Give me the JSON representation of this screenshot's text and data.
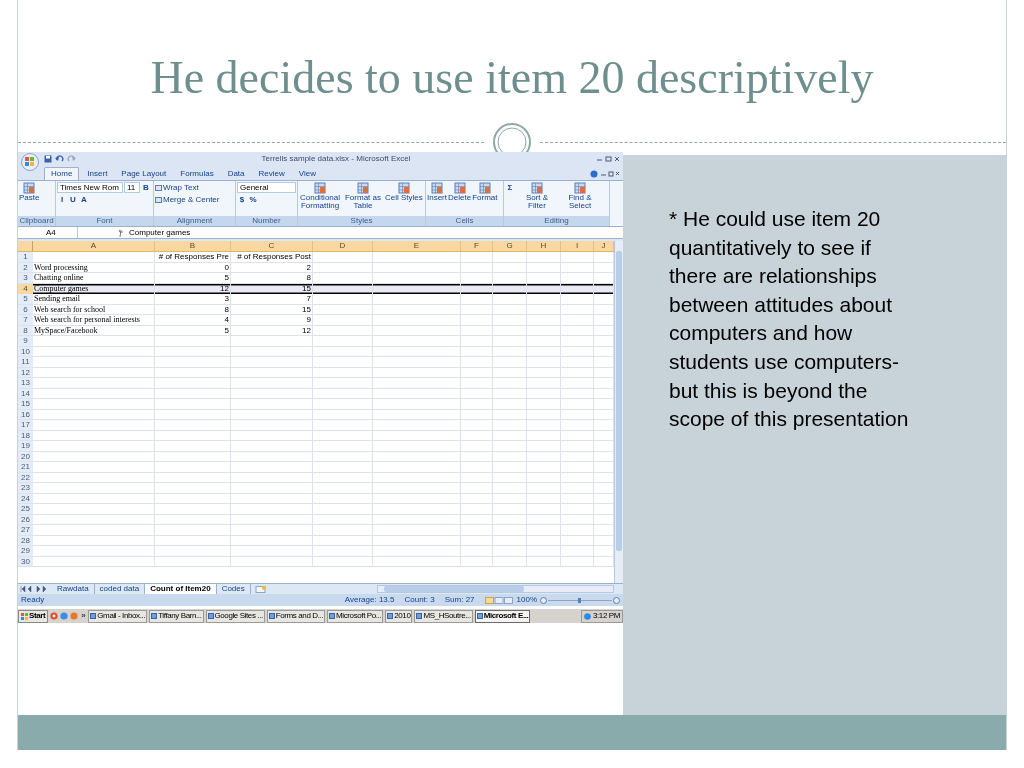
{
  "slide": {
    "title": "He decides to use item 20 descriptively",
    "note": "* He could use item 20 quantitatively to see if there are relationships between attitudes about computers and how students use computers- but this is beyond the scope of this presentation"
  },
  "excel": {
    "title": "Terrells sample data.xlsx - Microsoft Excel",
    "ribbon_tabs": [
      {
        "label": "Home",
        "selected": true
      },
      {
        "label": "Insert",
        "selected": false
      },
      {
        "label": "Page Layout",
        "selected": false
      },
      {
        "label": "Formulas",
        "selected": false
      },
      {
        "label": "Data",
        "selected": false
      },
      {
        "label": "Review",
        "selected": false
      },
      {
        "label": "View",
        "selected": false
      }
    ],
    "ribbon_groups": [
      {
        "name": "Clipboard",
        "items": [
          {
            "kind": "big",
            "label": "Paste"
          }
        ]
      },
      {
        "name": "Font",
        "items": [
          {
            "kind": "combo",
            "label": "Times New Rom"
          },
          {
            "kind": "combo",
            "label": "11"
          },
          {
            "kind": "glyph",
            "label": "B"
          },
          {
            "kind": "glyph",
            "label": "I"
          },
          {
            "kind": "glyph",
            "label": "U"
          },
          {
            "kind": "glyph",
            "label": "A"
          }
        ]
      },
      {
        "name": "Alignment",
        "items": [
          {
            "kind": "small",
            "label": "Wrap Text"
          },
          {
            "kind": "small",
            "label": "Merge & Center"
          }
        ]
      },
      {
        "name": "Number",
        "items": [
          {
            "kind": "combo",
            "label": "General"
          },
          {
            "kind": "glyph",
            "label": "$"
          },
          {
            "kind": "glyph",
            "label": "%"
          }
        ]
      },
      {
        "name": "Styles",
        "items": [
          {
            "kind": "big",
            "label": "Conditional Formatting"
          },
          {
            "kind": "big",
            "label": "Format as Table"
          },
          {
            "kind": "big",
            "label": "Cell Styles"
          }
        ]
      },
      {
        "name": "Cells",
        "items": [
          {
            "kind": "big",
            "label": "Insert"
          },
          {
            "kind": "big",
            "label": "Delete"
          },
          {
            "kind": "big",
            "label": "Format"
          }
        ]
      },
      {
        "name": "Editing",
        "items": [
          {
            "kind": "glyph",
            "label": "Σ"
          },
          {
            "kind": "big",
            "label": "Sort & Filter"
          },
          {
            "kind": "big",
            "label": "Find & Select"
          }
        ]
      }
    ],
    "name_box": "A4",
    "formula": "Computer games",
    "columns": [
      "A",
      "B",
      "C",
      "D",
      "E",
      "F",
      "G",
      "H",
      "I",
      "J"
    ],
    "rows": [
      {
        "number": "1",
        "cells": [
          "",
          "# of Responses Pre",
          "# of Responses Post"
        ],
        "selected": false
      },
      {
        "number": "2",
        "cells": [
          "Word processing",
          "0",
          "2"
        ],
        "selected": false
      },
      {
        "number": "3",
        "cells": [
          "Chatting online",
          "5",
          "8"
        ],
        "selected": false
      },
      {
        "number": "4",
        "cells": [
          "Computer games",
          "12",
          "15"
        ],
        "selected": true
      },
      {
        "number": "5",
        "cells": [
          "Sending email",
          "3",
          "7"
        ],
        "selected": false
      },
      {
        "number": "6",
        "cells": [
          "Web search for school",
          "8",
          "15"
        ],
        "selected": false
      },
      {
        "number": "7",
        "cells": [
          "Web search for personal interests",
          "4",
          "9"
        ],
        "selected": false
      },
      {
        "number": "8",
        "cells": [
          "MySpace/Facebook",
          "5",
          "12"
        ],
        "selected": false
      },
      {
        "number": "9",
        "selected": false
      },
      {
        "number": "10",
        "selected": false
      },
      {
        "number": "11",
        "selected": false
      },
      {
        "number": "12",
        "selected": false
      },
      {
        "number": "13",
        "selected": false
      },
      {
        "number": "14",
        "selected": false
      },
      {
        "number": "15",
        "selected": false
      },
      {
        "number": "16",
        "selected": false
      },
      {
        "number": "17",
        "selected": false
      },
      {
        "number": "18",
        "selected": false
      },
      {
        "number": "19",
        "selected": false
      },
      {
        "number": "20",
        "selected": false
      },
      {
        "number": "21",
        "selected": false
      },
      {
        "number": "22",
        "selected": false
      },
      {
        "number": "23",
        "selected": false
      },
      {
        "number": "24",
        "selected": false
      },
      {
        "number": "25",
        "selected": false
      },
      {
        "number": "26",
        "selected": false
      },
      {
        "number": "27",
        "selected": false
      },
      {
        "number": "28",
        "selected": false
      },
      {
        "number": "29",
        "selected": false
      },
      {
        "number": "30",
        "selected": false
      }
    ],
    "sheet_tabs": [
      {
        "label": "Rawdata",
        "selected": false
      },
      {
        "label": "coded data",
        "selected": false
      },
      {
        "label": "Count of Item20",
        "selected": true
      },
      {
        "label": "Codes",
        "selected": false
      }
    ],
    "status": "Ready",
    "summary": [
      "Average: 13.5",
      "Count: 3",
      "Sum: 27"
    ],
    "zoom": "100%"
  },
  "taskbar": {
    "start": "Start",
    "more": "»",
    "items": [
      {
        "label": "Gmail - Inbox...",
        "active": false
      },
      {
        "label": "Tiffany Barn...",
        "active": false
      },
      {
        "label": "Google Sites ...",
        "active": false
      },
      {
        "label": "Forms and D...",
        "active": false
      },
      {
        "label": "Microsoft Po...",
        "active": false
      },
      {
        "label": "2010",
        "active": false
      },
      {
        "label": "MS_HSoutre...",
        "active": false
      },
      {
        "label": "Microsoft E...",
        "active": true
      }
    ],
    "clock": "3:12 PM"
  }
}
